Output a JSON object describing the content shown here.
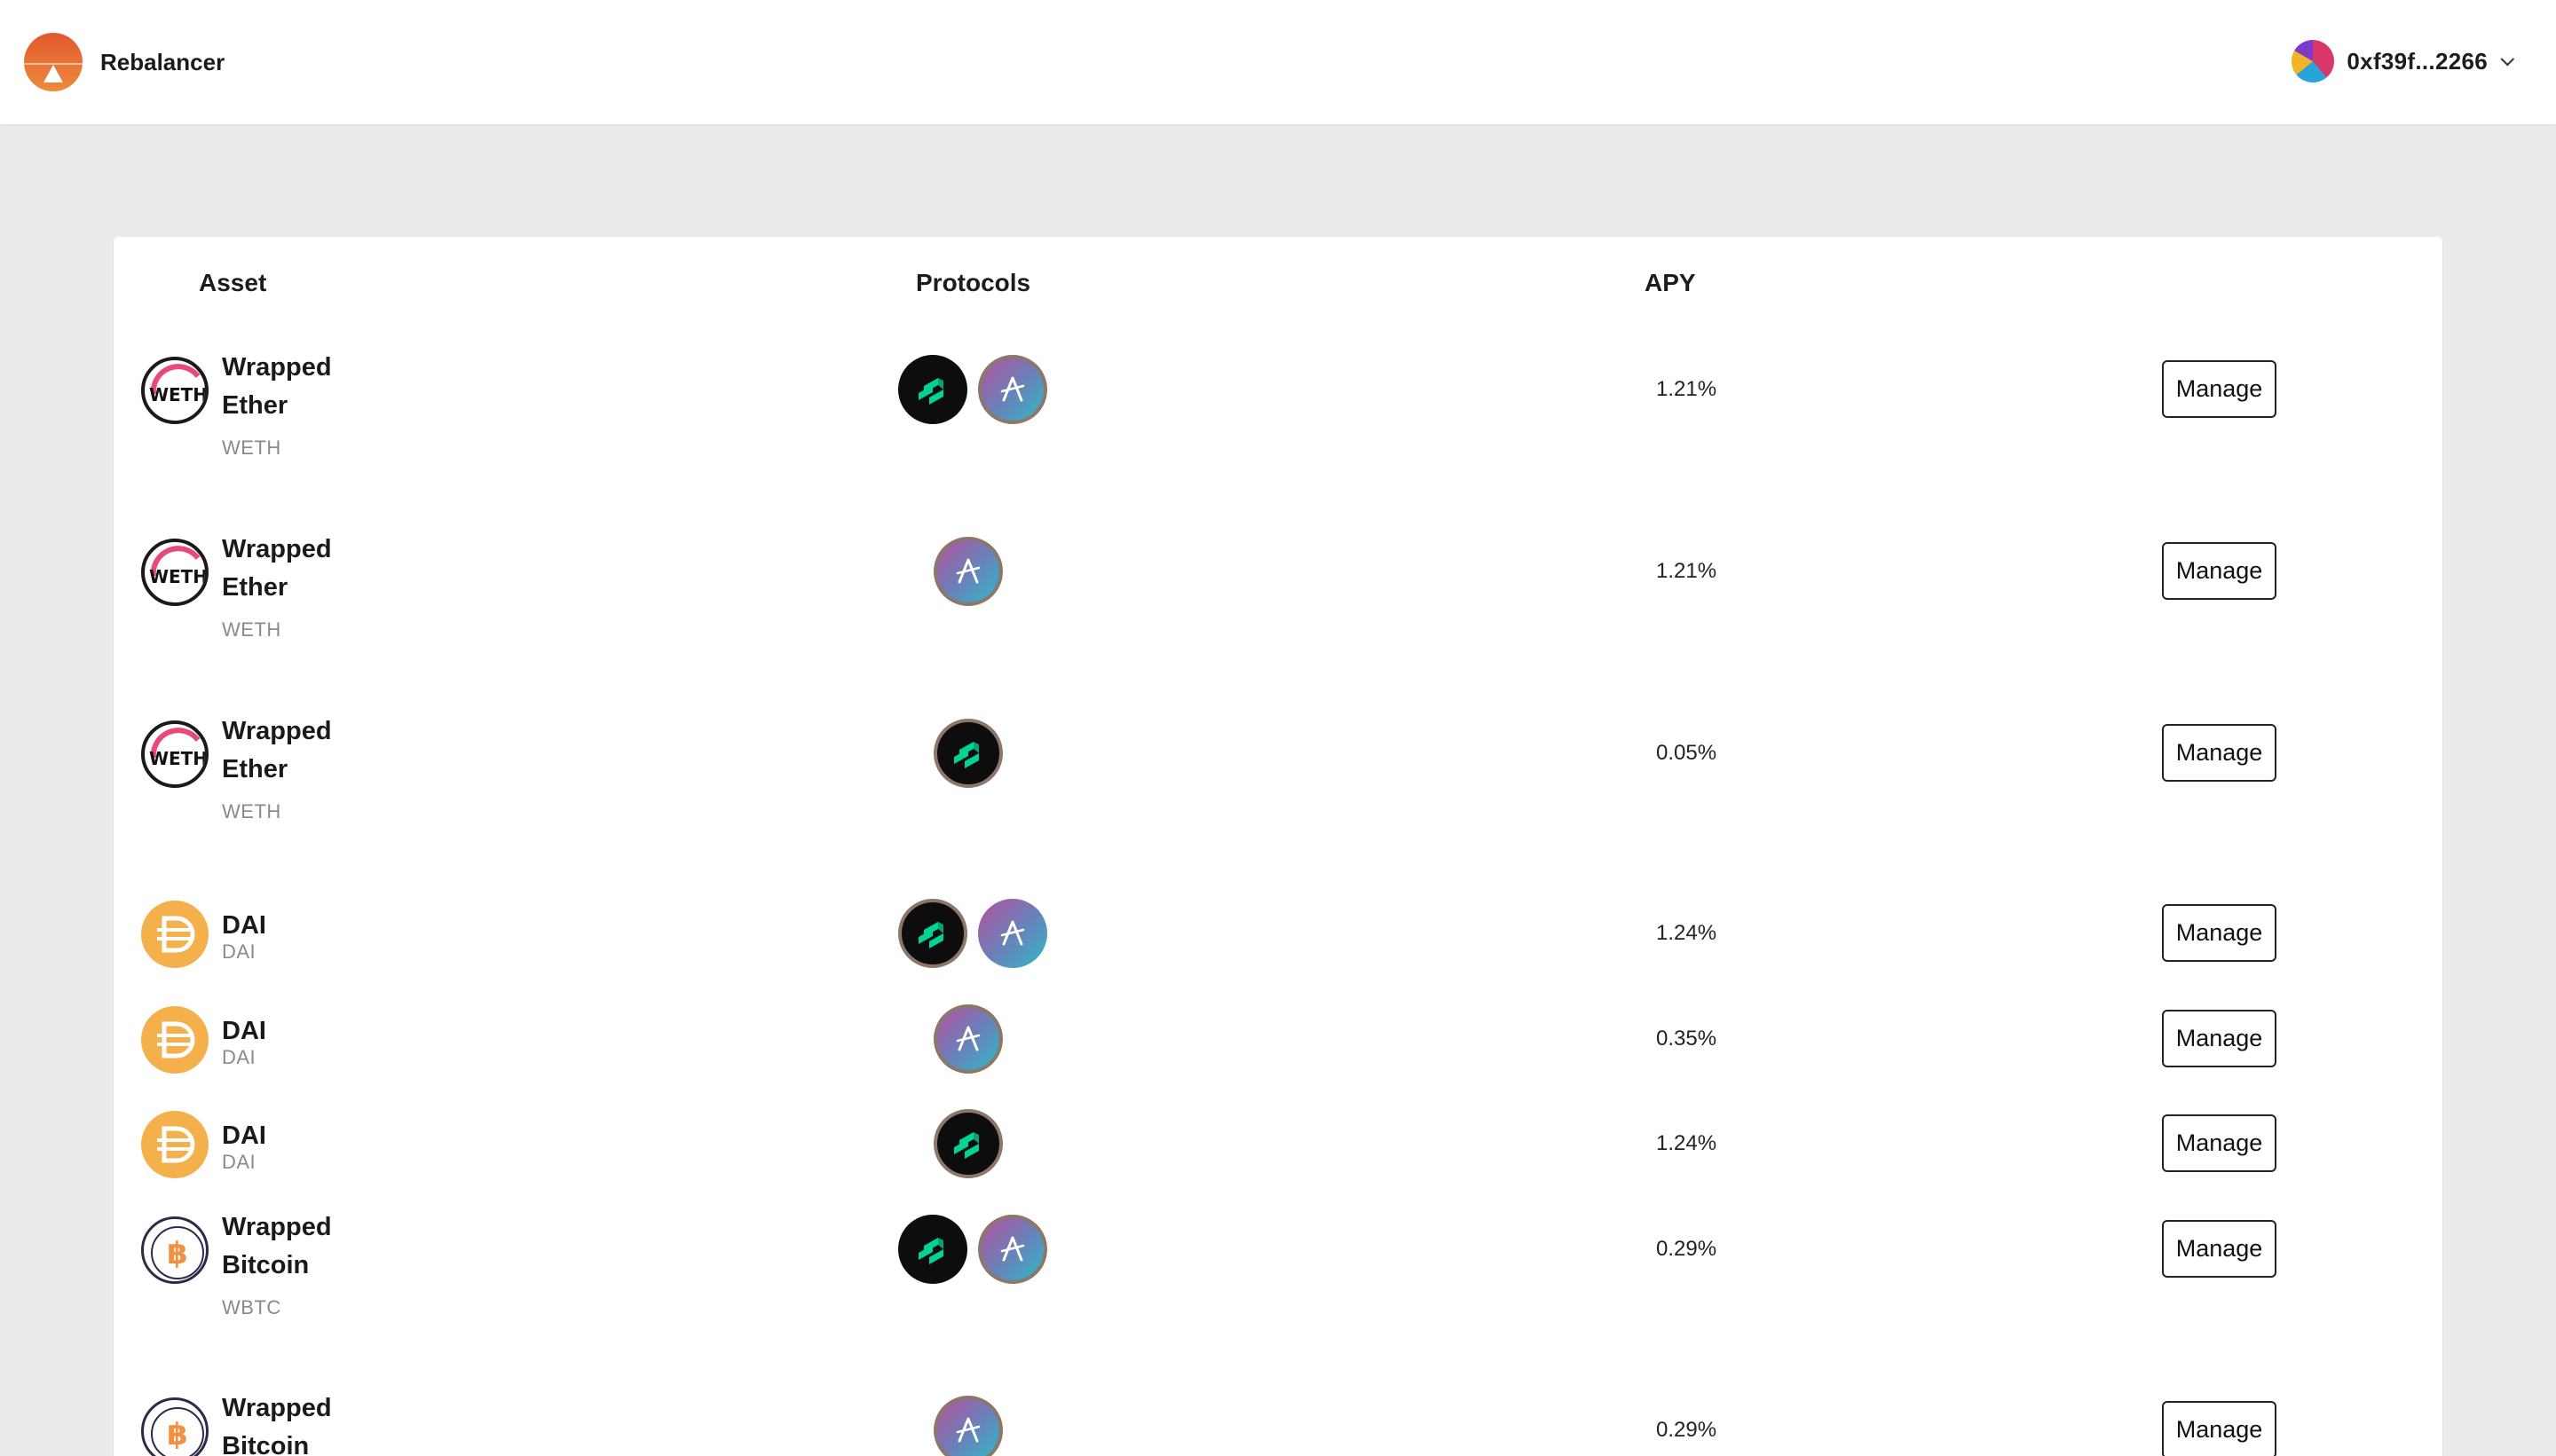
{
  "header": {
    "app_name": "Rebalancer",
    "logo_icon": "mountain-sunset-icon",
    "account": {
      "address": "0xf39f...2266",
      "avatar_icon": "jazzicon-avatar",
      "caret_icon": "chevron-down-icon"
    }
  },
  "table": {
    "columns": {
      "asset": "Asset",
      "protocols": "Protocols",
      "apy": "APY"
    },
    "manage_label": "Manage",
    "rows": [
      {
        "asset_name": "Wrapped Ether",
        "symbol": "WETH",
        "icon": "weth-icon",
        "protocols": [
          "compound",
          "aave"
        ],
        "apy": "1.21%"
      },
      {
        "asset_name": "Wrapped Ether",
        "symbol": "WETH",
        "icon": "weth-icon",
        "protocols": [
          "aave"
        ],
        "apy": "1.21%"
      },
      {
        "asset_name": "Wrapped Ether",
        "symbol": "WETH",
        "icon": "weth-icon",
        "protocols": [
          "compound"
        ],
        "apy": "0.05%"
      },
      {
        "asset_name": "DAI",
        "symbol": "DAI",
        "icon": "dai-icon",
        "protocols": [
          "compound",
          "aave"
        ],
        "apy": "1.24%"
      },
      {
        "asset_name": "DAI",
        "symbol": "DAI",
        "icon": "dai-icon",
        "protocols": [
          "aave"
        ],
        "apy": "0.35%"
      },
      {
        "asset_name": "DAI",
        "symbol": "DAI",
        "icon": "dai-icon",
        "protocols": [
          "compound"
        ],
        "apy": "1.24%"
      },
      {
        "asset_name": "Wrapped Bitcoin",
        "symbol": "WBTC",
        "icon": "wbtc-icon",
        "protocols": [
          "compound",
          "aave"
        ],
        "apy": "0.29%"
      },
      {
        "asset_name": "Wrapped Bitcoin",
        "symbol": "",
        "icon": "wbtc-icon",
        "protocols": [
          "aave"
        ],
        "apy": "0.29%"
      }
    ]
  },
  "colors": {
    "page_bg": "#ebebeb",
    "brand_orange": "#e2582e",
    "dai_gold": "#f4b04b",
    "compound_green": "#00d395",
    "aave_gradient": [
      "#b6509e",
      "#2ebac6"
    ]
  }
}
